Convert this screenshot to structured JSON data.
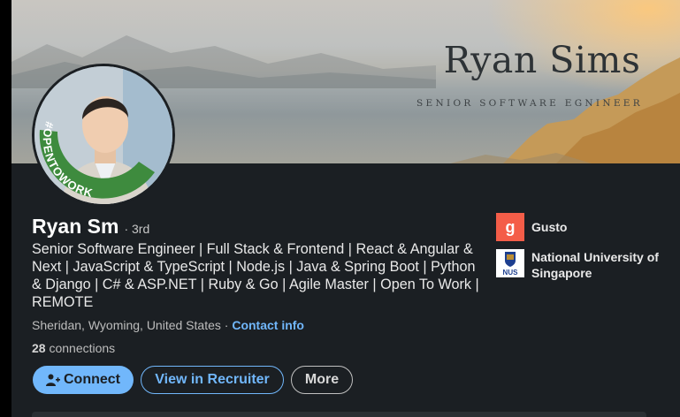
{
  "profile": {
    "banner_name": "Ryan Sims",
    "banner_title": "SENIOR SOFTWARE EGNINEER",
    "avatar_badge": "#OPENTOWORK",
    "name": "Ryan Sm",
    "degree": "· 3rd",
    "headline": "Senior Software Engineer | Full Stack & Frontend | React & Angular & Next | JavaScript & TypeScript | Node.js | Java & Spring Boot | Python & Django | C# & ASP.NET | Ruby & Go | Agile Master | Open To Work | REMOTE",
    "location": "Sheridan, Wyoming, United States",
    "location_sep": " · ",
    "contact_info": "Contact info",
    "connections_count": "28",
    "connections_label": " connections"
  },
  "actions": {
    "connect": "Connect",
    "recruiter": "View in Recruiter",
    "more": "More"
  },
  "companies": [
    {
      "name": "Gusto",
      "logo_text": "g",
      "logo_color": "#f45d48"
    },
    {
      "name": "National University of Singapore",
      "logo_text": "NUS"
    }
  ],
  "colors": {
    "background": "#1b1f23",
    "accent": "#71b7fb",
    "badge_green": "#3e8b3e"
  }
}
